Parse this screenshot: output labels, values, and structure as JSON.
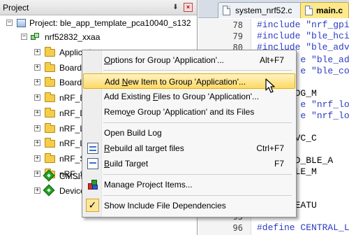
{
  "panel": {
    "title": "Project",
    "pin_glyph": "⬇",
    "close_glyph": "×"
  },
  "tree": {
    "project_label": "Project: ble_app_template_pca10040_s132",
    "target_label": "nrf52832_xxaa",
    "groups": [
      "Applicati",
      "Board",
      "Board",
      "nRF_B",
      "nRF_D",
      "nRF_L",
      "nRF_L",
      "nRF_S",
      "nRF_S",
      "CMSIS",
      "Device"
    ]
  },
  "editor": {
    "tabs": [
      {
        "label": "system_nrf52.c",
        "active": false
      },
      {
        "label": "main.c",
        "active": true
      }
    ],
    "lines": [
      {
        "n": "78",
        "code": "#include \"nrf_gpio"
      },
      {
        "n": "79",
        "code": "#include \"ble_hci"
      },
      {
        "n": "80",
        "code": "#include \"ble_adv"
      },
      {
        "n": "",
        "code": "        e \"ble_adv"
      },
      {
        "n": "",
        "code": "        e \"ble_con"
      },
      {
        "n": "",
        "code": ""
      },
      {
        "n": "",
        "code": "  NRF_LOG_M"
      },
      {
        "n": "",
        "code": "        e \"nrf_log"
      },
      {
        "n": "",
        "code": "        e \"nrf_log"
      },
      {
        "n": "",
        "code": ""
      },
      {
        "n": "",
        "code": "  IS_SRVC_C"
      },
      {
        "n": "",
        "code": ""
      },
      {
        "n": "",
        "code": "  NRF_SD_BLE_A"
      },
      {
        "n": "",
        "code": "  NRF_BLE_M"
      },
      {
        "n": "",
        "code": ""
      },
      {
        "n": "",
        "code": ""
      },
      {
        "n": "",
        "code": "  APP_FEATU"
      },
      {
        "n": "95",
        "code": ""
      },
      {
        "n": "96",
        "code": "#define CENTRAL_L"
      }
    ]
  },
  "context_menu": {
    "items": [
      {
        "label": "Options for Group 'Application'...",
        "underline": "O",
        "shortcut": "Alt+F7",
        "icon": ""
      },
      {
        "label": "Add New  Item to Group 'Application'...",
        "underline": "N",
        "shortcut": "",
        "icon": "",
        "highlighted": true
      },
      {
        "label": "Add Existing Files to Group 'Application'...",
        "underline": "F",
        "shortcut": "",
        "icon": ""
      },
      {
        "label": "Remove Group 'Application' and its Files",
        "underline": "v",
        "shortcut": "",
        "icon": ""
      },
      {
        "label": "Open Build Log",
        "underline": "",
        "shortcut": "",
        "icon": ""
      },
      {
        "label": "Rebuild all target files",
        "underline": "R",
        "shortcut": "Ctrl+F7",
        "icon": "rebuild-icon"
      },
      {
        "label": "Build Target",
        "underline": "B",
        "shortcut": "F7",
        "icon": "build-icon"
      },
      {
        "label": "Manage Project Items...",
        "underline": "",
        "shortcut": "",
        "icon": "manage-icon"
      },
      {
        "label": "Show Include File Dependencies",
        "underline": "",
        "shortcut": "",
        "icon": "check-icon",
        "checked": true
      }
    ],
    "highlight_colors": {
      "top": "#fff3c4",
      "bottom": "#ffd966",
      "border": "#e0b000"
    }
  }
}
